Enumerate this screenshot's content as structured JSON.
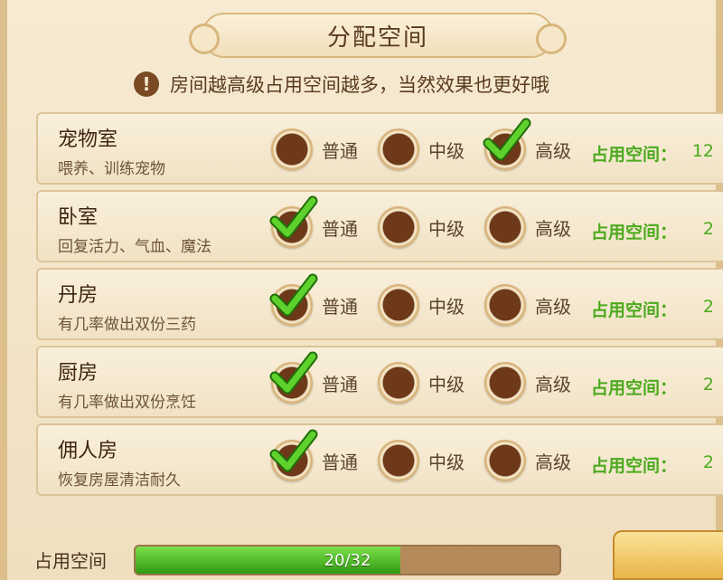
{
  "dialog": {
    "title": "分配空间",
    "hint": "房间越高级占用空间越多，当然效果也更好哦",
    "hint_icon": "exclamation-icon"
  },
  "option_labels": [
    "普通",
    "中级",
    "高级"
  ],
  "space_label": "占用空间：",
  "rooms": [
    {
      "name": "宠物室",
      "desc": "喂养、训练宠物",
      "selected": 3,
      "space": "12"
    },
    {
      "name": "卧室",
      "desc": "回复活力、气血、魔法",
      "selected": 1,
      "space": "2"
    },
    {
      "name": "丹房",
      "desc": "有几率做出双份三药",
      "selected": 1,
      "space": "2"
    },
    {
      "name": "厨房",
      "desc": "有几率做出双份烹饪",
      "selected": 1,
      "space": "2"
    },
    {
      "name": "佣人房",
      "desc": "恢复房屋清洁耐久",
      "selected": 1,
      "space": "2"
    }
  ],
  "footer": {
    "label": "占用空间",
    "used": 20,
    "total": 32,
    "text": "20/32",
    "confirm": ""
  },
  "colors": {
    "accent_green": "#4caa1e",
    "radio_brown": "#6d3918",
    "check_green": "#3ea51a"
  }
}
